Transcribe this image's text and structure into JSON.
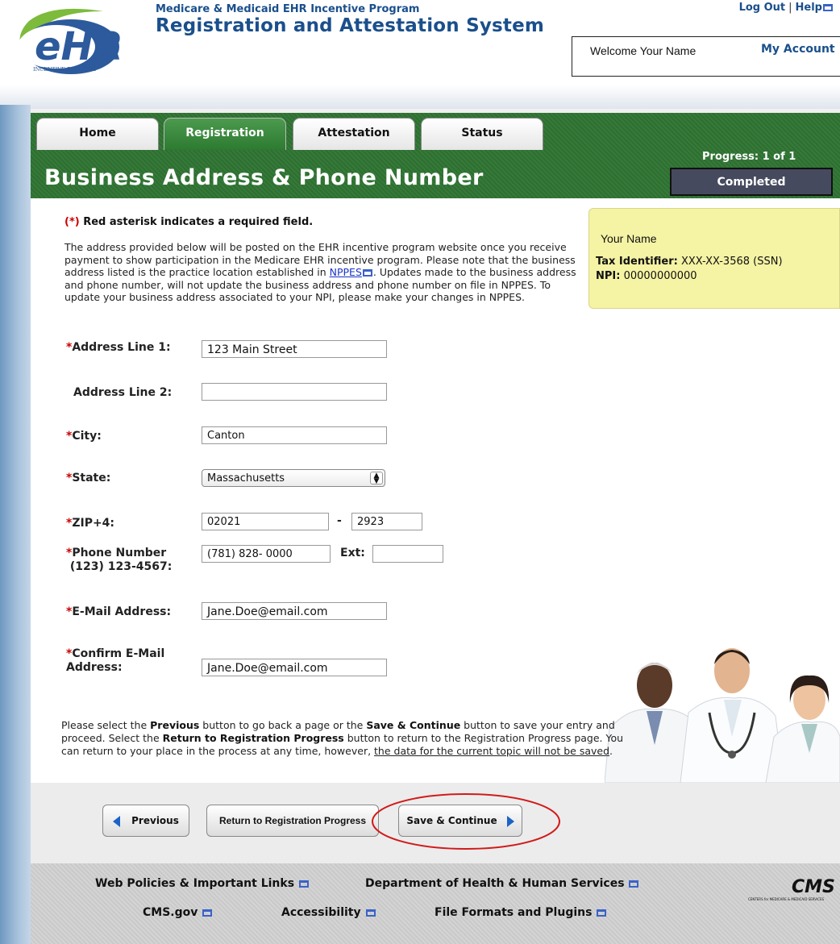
{
  "header": {
    "logo_text": "eHR",
    "logo_subtext": "INCENTIVE PROGRAM",
    "program": "Medicare & Medicaid EHR Incentive Program",
    "system_title": "Registration and Attestation System",
    "logout": "Log Out",
    "help": "Help",
    "welcome": "Welcome Your Name",
    "my_account": "My Account"
  },
  "tabs": [
    {
      "label": "Home",
      "active": false
    },
    {
      "label": "Registration",
      "active": true
    },
    {
      "label": "Attestation",
      "active": false
    },
    {
      "label": "Status",
      "active": false
    }
  ],
  "page": {
    "title": "Business Address & Phone Number",
    "progress": "Progress: 1 of 1",
    "progress_status": "Completed"
  },
  "notes": {
    "required_asterisk": "(*)",
    "required": " Red asterisk indicates a required field.",
    "intro_before_link": "The address provided below will be posted on the EHR incentive program website once you receive payment to show participation in the Medicare EHR incentive program. Please note that the business address listed is the practice location established in ",
    "intro_link": "NPPES",
    "intro_after_link": ". Updates made to the business address and phone number, will not update the business address and phone number on file in NPPES. To update your business address associated to your NPI, please make your changes in NPPES."
  },
  "info": {
    "name": "Your Name",
    "tax_label": "Tax Identifier:",
    "tax_value": "XXX-XX-3568 (SSN)",
    "npi_label": "NPI:",
    "npi_value": "00000000000"
  },
  "form": {
    "asterisk": "*",
    "address1_label": "Address Line 1:",
    "address1_value": "123 Main Street",
    "address2_label": "Address Line 2:",
    "address2_value": "",
    "city_label": "City:",
    "city_value": "Canton",
    "state_label": "State:",
    "state_value": "Massachusetts",
    "zip_label": "ZIP+4:",
    "zip_value": "02021",
    "zip_dash": "-",
    "zip4_value": "2923",
    "phone_label": "Phone Number",
    "phone_format": "(123) 123-4567:",
    "phone_value": "(781) 828- 0000",
    "ext_label": "Ext:",
    "ext_value": "",
    "email_label": "E-Mail Address:",
    "email_value": "Jane.Doe@email.com",
    "confirm_label_1": "Confirm E-Mail",
    "confirm_label_2": "Address:",
    "confirm_value": "Jane.Doe@email.com"
  },
  "outro": {
    "t1": "Please select the ",
    "b1": "Previous",
    "t2": " button to go back a page or the ",
    "b2": "Save & Continue",
    "t3": " button to save your entry and proceed. Select the ",
    "b3": "Return to Registration Progress",
    "t4": " button to return to the Registration Progress page. You can return to your place in the process at any time, however, ",
    "u1": "the data for the current topic will not be saved",
    "t5": "."
  },
  "buttons": {
    "previous": "Previous",
    "return": "Return to Registration Progress",
    "save": "Save & Continue"
  },
  "footer": {
    "web_policies": "Web Policies & Important Links",
    "hhs": "Department of Health & Human Services",
    "cms_gov": "CMS.gov",
    "accessibility": "Accessibility",
    "file_formats": "File Formats and Plugins",
    "cms_logo": "CMS",
    "cms_logo_sub": "CENTERS for MEDICARE & MEDICAID SERVICES"
  },
  "colors": {
    "brand_blue": "#1a4f8c",
    "green_bar": "#2f6e32",
    "required_red": "#cc0000",
    "info_yellow": "#f5f3a4",
    "annotation_red": "#d11a1a"
  }
}
